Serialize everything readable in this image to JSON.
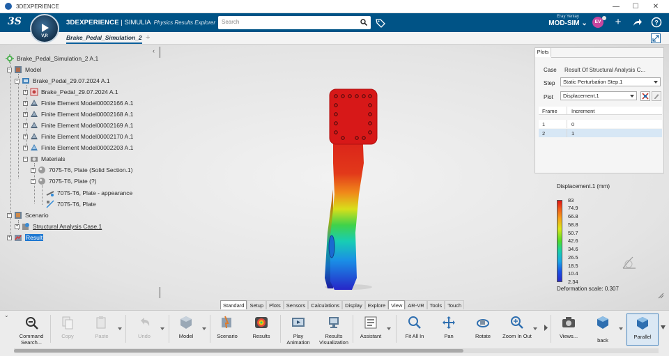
{
  "window": {
    "title": "3DEXPERIENCE",
    "controls": [
      "minimize",
      "maximize",
      "close"
    ]
  },
  "header": {
    "brand_main": "3DEXPERIENCE",
    "brand_sep": " | ",
    "brand_product": "SIMULIA",
    "brand_app": "Physics Results Explorer",
    "compass_label": "V,R",
    "search_placeholder": "Search",
    "user_name": "Eray Yeniay",
    "user_role": "MOD-SIM",
    "avatar_initials": "EV"
  },
  "tabs": {
    "active": "Brake_Pedal_Simulation_2",
    "add": "+"
  },
  "tree": {
    "collapse": "‹",
    "nodes": [
      {
        "label": "Brake_Pedal_Simulation_2 A.1",
        "icon": "simulation-icon"
      },
      {
        "label": "Model",
        "icon": "model-icon"
      },
      {
        "label": "Brake_Pedal_29.07.2024 A.1",
        "icon": "product-icon"
      },
      {
        "label": "Brake_Pedal_29.07.2024 A.1",
        "icon": "part-icon"
      },
      {
        "label": "Finite Element Model00002166 A.1",
        "icon": "fem-icon"
      },
      {
        "label": "Finite Element Model00002168 A.1",
        "icon": "fem-icon"
      },
      {
        "label": "Finite Element Model00002169 A.1",
        "icon": "fem-icon"
      },
      {
        "label": "Finite Element Model00002170 A.1",
        "icon": "fem-icon"
      },
      {
        "label": "Finite Element Model00002203 A.1",
        "icon": "fem-icon"
      },
      {
        "label": "Materials",
        "icon": "materials-icon"
      },
      {
        "label": "7075-T6, Plate (Solid Section.1)",
        "icon": "material-sphere-icon"
      },
      {
        "label": "7075-T6, Plate (?)",
        "icon": "material-sphere-icon"
      },
      {
        "label": "7075-T6, Plate - appearance",
        "icon": "appearance-icon"
      },
      {
        "label": "7075-T6, Plate",
        "icon": "material-domain-icon"
      },
      {
        "label": "Scenario",
        "icon": "scenario-icon"
      },
      {
        "label": "Structural Analysis Case.1",
        "icon": "analysis-case-icon"
      },
      {
        "label": "Result",
        "icon": "result-icon"
      }
    ]
  },
  "plots_panel": {
    "tab": "Plots",
    "case_label": "Case",
    "case_value": "Result Of Structural Analysis C...",
    "step_label": "Step",
    "step_value": "Static Perturbation Step.1",
    "plot_label": "Plot",
    "plot_value": "Displacement.1",
    "columns": [
      "Frame",
      "Increment"
    ],
    "rows": [
      [
        "1",
        "0"
      ],
      [
        "2",
        "1"
      ]
    ],
    "selected_row": 1
  },
  "legend": {
    "title": "Displacement.1 (mm)",
    "ticks": [
      "83",
      "74.9",
      "66.8",
      "58.8",
      "50.7",
      "42.6",
      "34.6",
      "26.5",
      "18.5",
      "10.4",
      "2.34"
    ],
    "deformation": "Deformation scale: 0.307"
  },
  "section_tabs": [
    "Standard",
    "Setup",
    "Plots",
    "Sensors",
    "Calculations",
    "Display",
    "Explore",
    "View",
    "AR-VR",
    "Tools",
    "Touch"
  ],
  "active_section": "View",
  "commands": [
    {
      "label": "Command Search...",
      "icon": "command-search-icon"
    },
    {
      "label": "Copy",
      "icon": "copy-icon",
      "disabled": true
    },
    {
      "label": "Paste",
      "icon": "paste-icon",
      "disabled": true
    },
    {
      "label": "Undo",
      "icon": "undo-icon",
      "disabled": true
    },
    {
      "label": "Model",
      "icon": "model-cmd-icon"
    },
    {
      "label": "Scenario",
      "icon": "scenario-cmd-icon"
    },
    {
      "label": "Results",
      "icon": "results-cmd-icon"
    },
    {
      "label": "Play Animation",
      "icon": "play-animation-icon"
    },
    {
      "label": "Results Visualization ...",
      "icon": "results-visualization-icon"
    },
    {
      "label": "Assistant",
      "icon": "assistant-icon"
    },
    {
      "label": "Fit All In",
      "icon": "fit-all-in-icon"
    },
    {
      "label": "Pan",
      "icon": "pan-icon"
    },
    {
      "label": "Rotate",
      "icon": "rotate-icon"
    },
    {
      "label": "Zoom In Out",
      "icon": "zoom-icon"
    },
    {
      "label": "Views...",
      "icon": "views-icon"
    },
    {
      "label": "back",
      "icon": "back-view-icon"
    },
    {
      "label": "Parallel",
      "icon": "parallel-icon"
    }
  ],
  "colors": {
    "header": "#005386",
    "accent": "#1f78d1",
    "avatar": "#c8469f"
  }
}
